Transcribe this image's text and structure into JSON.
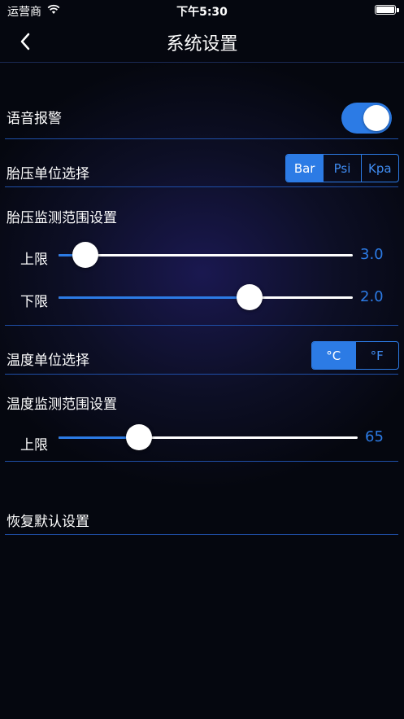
{
  "status_bar": {
    "carrier": "运营商",
    "time": "下午5:30"
  },
  "nav": {
    "title": "系统设置"
  },
  "voice_alarm": {
    "label": "语音报警",
    "on": true
  },
  "pressure_unit": {
    "label": "胎压单位选择",
    "options": [
      "Bar",
      "Psi",
      "Kpa"
    ],
    "selected": "Bar"
  },
  "pressure_range": {
    "label": "胎压监测范围设置",
    "upper": {
      "label": "上限",
      "value": "3.0",
      "fraction": 0.09
    },
    "lower": {
      "label": "下限",
      "value": "2.0",
      "fraction": 0.65
    }
  },
  "temp_unit": {
    "label": "温度单位选择",
    "options": [
      "°C",
      "°F"
    ],
    "selected": "°C"
  },
  "temp_range": {
    "label": "温度监测范围设置",
    "upper": {
      "label": "上限",
      "value": "65",
      "fraction": 0.27
    }
  },
  "reset": {
    "label": "恢复默认设置"
  },
  "colors": {
    "accent": "#2c7be5",
    "separator": "#1f4fa8"
  }
}
